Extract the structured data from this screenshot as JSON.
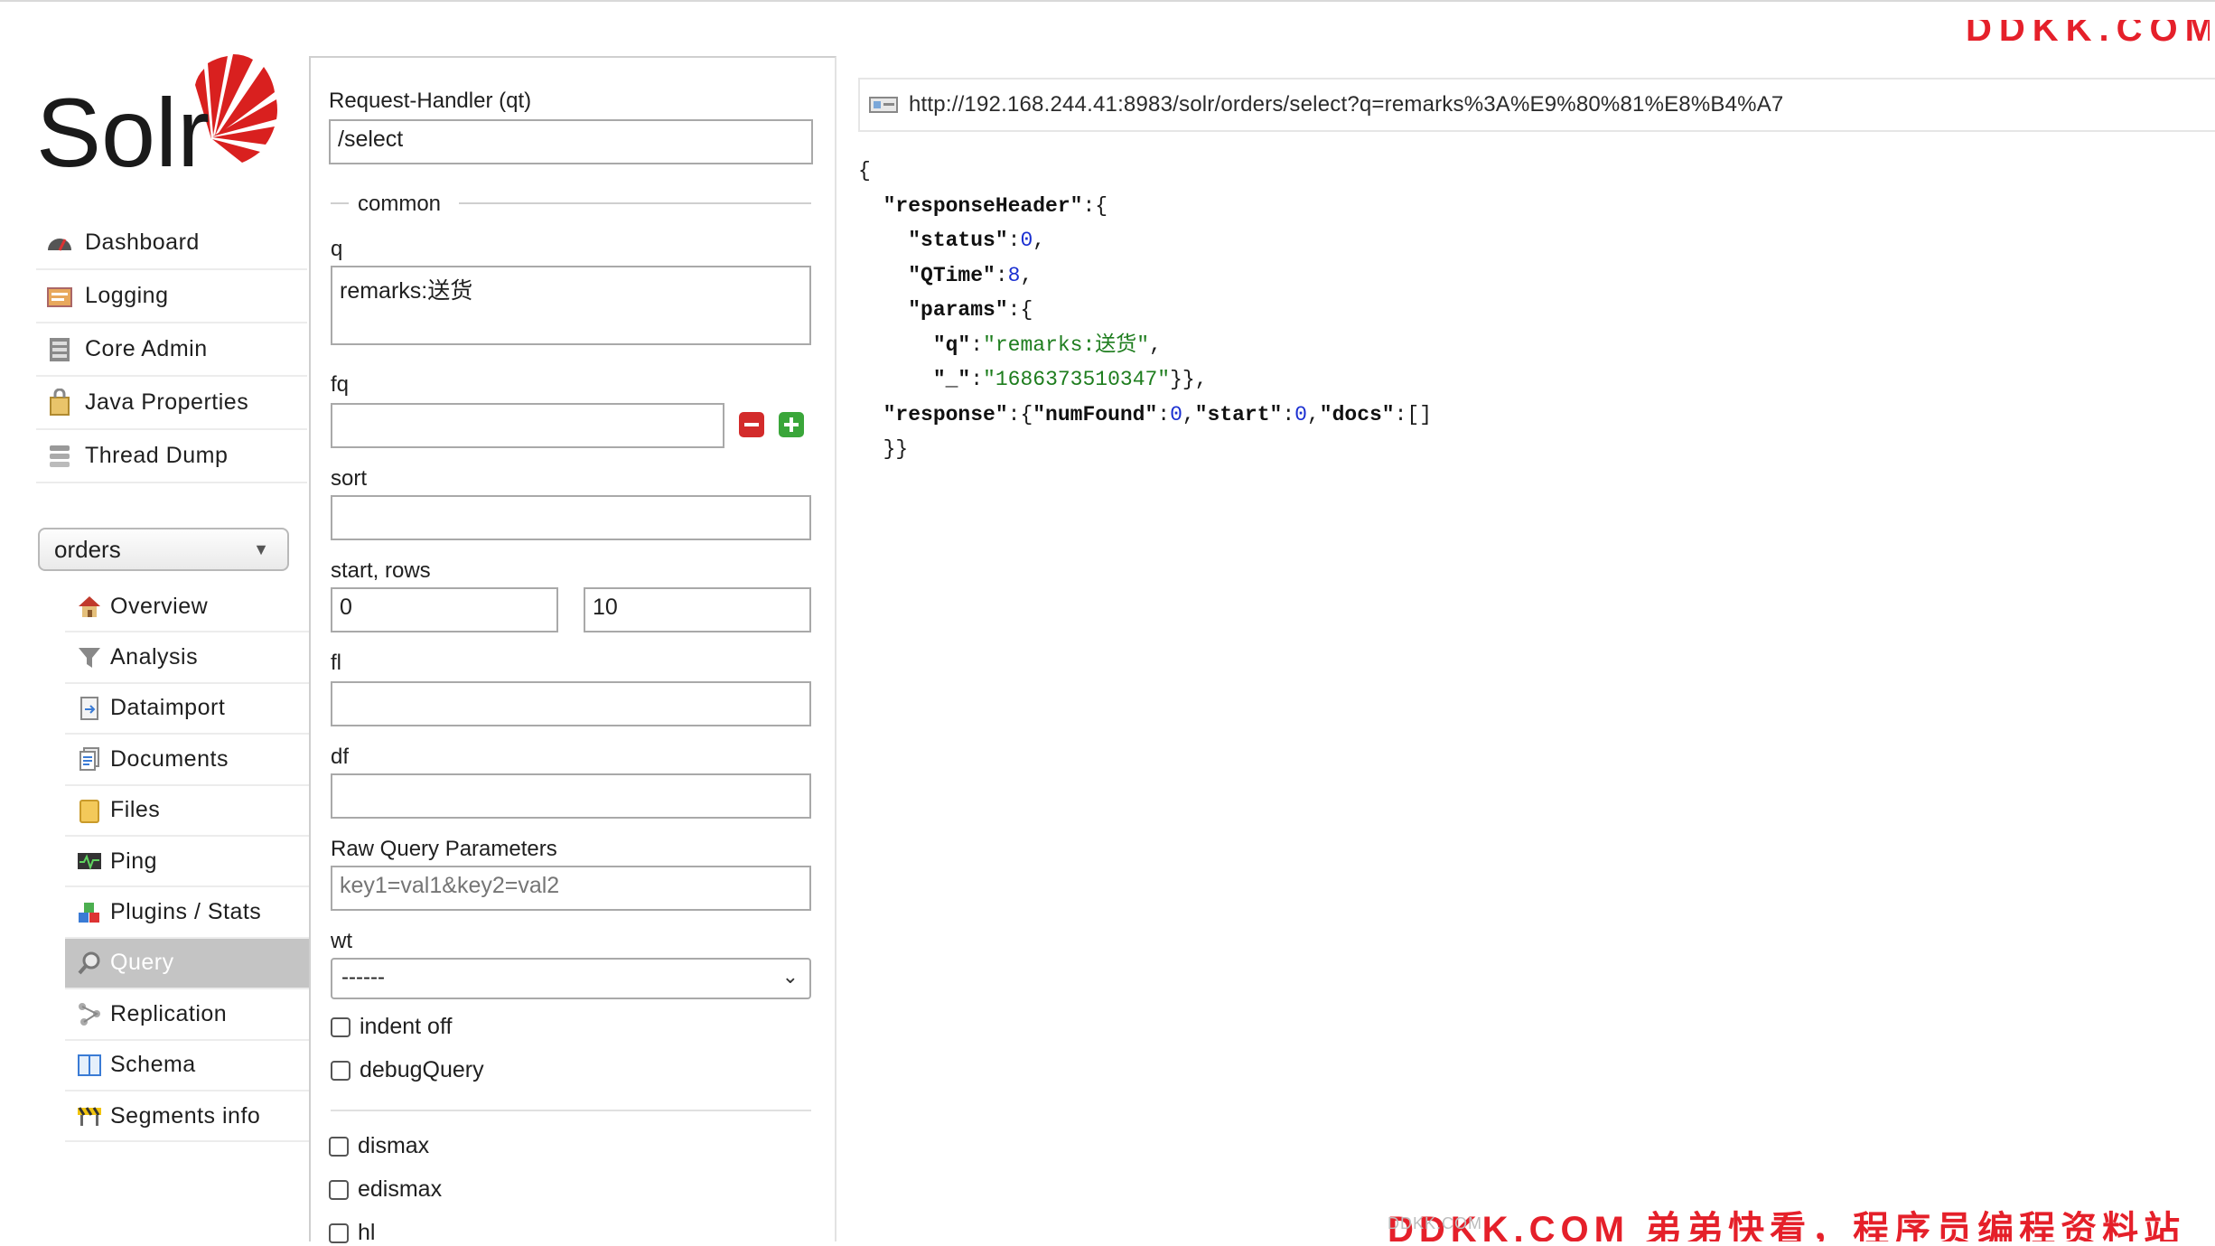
{
  "app": {
    "logo_text": "Solr",
    "watermark_top": "DDKK.COM",
    "watermark_bottom": "DDKK.COM 弟弟快看，程序员编程资料站",
    "watermark_corner": "DDKK.COM"
  },
  "sidebar": {
    "items": [
      {
        "label": "Dashboard",
        "icon": "dashboard-icon"
      },
      {
        "label": "Logging",
        "icon": "logging-icon"
      },
      {
        "label": "Core Admin",
        "icon": "core-admin-icon"
      },
      {
        "label": "Java Properties",
        "icon": "java-properties-icon"
      },
      {
        "label": "Thread Dump",
        "icon": "thread-dump-icon"
      }
    ],
    "core_selector": {
      "value": "orders"
    },
    "core_items": [
      {
        "label": "Overview",
        "icon": "house-icon"
      },
      {
        "label": "Analysis",
        "icon": "funnel-icon"
      },
      {
        "label": "Dataimport",
        "icon": "dataimport-icon"
      },
      {
        "label": "Documents",
        "icon": "documents-icon"
      },
      {
        "label": "Files",
        "icon": "folder-icon"
      },
      {
        "label": "Ping",
        "icon": "ping-icon"
      },
      {
        "label": "Plugins / Stats",
        "icon": "plugins-icon"
      },
      {
        "label": "Query",
        "icon": "magnifier-icon",
        "active": true
      },
      {
        "label": "Replication",
        "icon": "replication-icon"
      },
      {
        "label": "Schema",
        "icon": "schema-icon"
      },
      {
        "label": "Segments info",
        "icon": "segments-icon"
      }
    ]
  },
  "query_form": {
    "request_handler_label": "Request-Handler (qt)",
    "request_handler_value": "/select",
    "common_legend": "common",
    "q_label": "q",
    "q_value": "remarks:送货",
    "fq_label": "fq",
    "fq_value": "",
    "sort_label": "sort",
    "sort_value": "",
    "start_rows_label": "start, rows",
    "start_value": "0",
    "rows_value": "10",
    "fl_label": "fl",
    "fl_value": "",
    "df_label": "df",
    "df_value": "",
    "raw_params_label": "Raw Query Parameters",
    "raw_params_placeholder": "key1=val1&key2=val2",
    "wt_label": "wt",
    "wt_value": "------",
    "indent_label": "indent off",
    "debug_label": "debugQuery",
    "dismax_label": "dismax",
    "edismax_label": "edismax",
    "hl_label": "hl"
  },
  "result": {
    "url": "http://192.168.244.41:8983/solr/orders/select?q=remarks%3A%E9%80%81%E8%B4%A7",
    "response": {
      "open_brace": "{",
      "response_header_key": "\"responseHeader\"",
      "status_key": "\"status\"",
      "status_value": "0",
      "qtime_key": "\"QTime\"",
      "qtime_value": "8",
      "params_key": "\"params\"",
      "q_key": "\"q\"",
      "q_value": "\"remarks:送货\"",
      "underscore_key": "\"_\"",
      "underscore_value": "\"1686373510347\"",
      "response_key": "\"response\"",
      "numfound_key": "\"numFound\"",
      "numfound_value": "0",
      "start_key": "\"start\"",
      "start_value": "0",
      "docs_key": "\"docs\"",
      "close_brace": "}}"
    }
  }
}
